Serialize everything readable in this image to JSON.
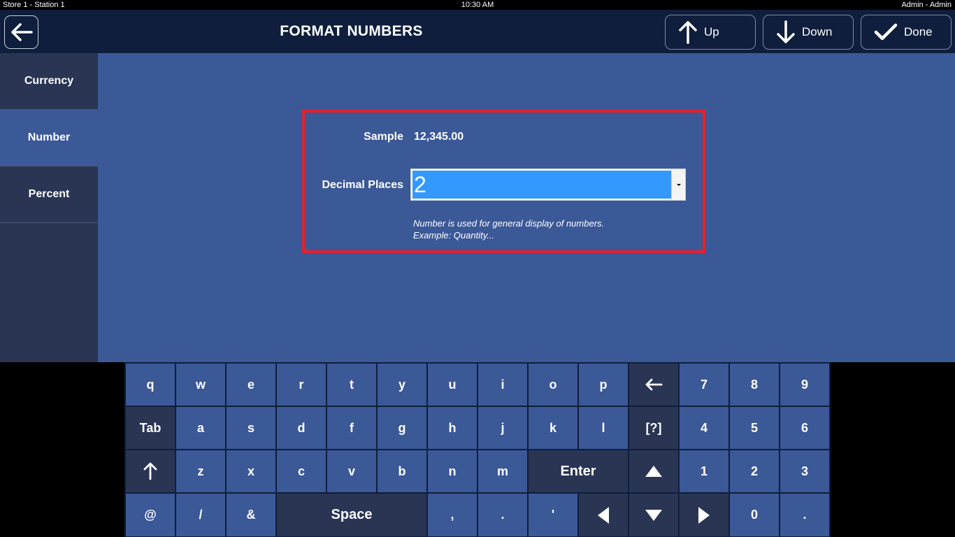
{
  "status_bar": {
    "left": "Store 1 - Station 1",
    "time": "10:30 AM",
    "user": "Admin - Admin"
  },
  "header": {
    "title": "FORMAT NUMBERS",
    "buttons": {
      "up": "Up",
      "down": "Down",
      "done": "Done"
    }
  },
  "sidebar": {
    "items": [
      {
        "label": "Currency",
        "active": false
      },
      {
        "label": "Number",
        "active": true
      },
      {
        "label": "Percent",
        "active": false
      }
    ]
  },
  "form": {
    "sample_label": "Sample",
    "sample_value": "12,345.00",
    "decimal_label": "Decimal Places",
    "decimal_value": "2",
    "hint_line1": "Number is used for general display of numbers.",
    "hint_line2": "Example: Quantity..."
  },
  "keyboard": {
    "row1": [
      "q",
      "w",
      "e",
      "r",
      "t",
      "y",
      "u",
      "i",
      "o",
      "p"
    ],
    "row2": [
      "Tab",
      "a",
      "s",
      "d",
      "f",
      "g",
      "h",
      "j",
      "k",
      "l",
      "[?]"
    ],
    "row3": [
      "z",
      "x",
      "c",
      "v",
      "b",
      "n",
      "m",
      "Enter"
    ],
    "row4": [
      "@",
      "/",
      "&",
      "Space",
      ",",
      ".",
      "'"
    ],
    "numpad": [
      "7",
      "8",
      "9",
      "4",
      "5",
      "6",
      "1",
      "2",
      "3",
      "0",
      "."
    ]
  },
  "colors": {
    "header_bg": "#0e1e3c",
    "panel_bg": "#3b5897",
    "sidebar_bg": "#293553",
    "highlight_border": "#e3222f",
    "selection_bg": "#3399ff"
  }
}
